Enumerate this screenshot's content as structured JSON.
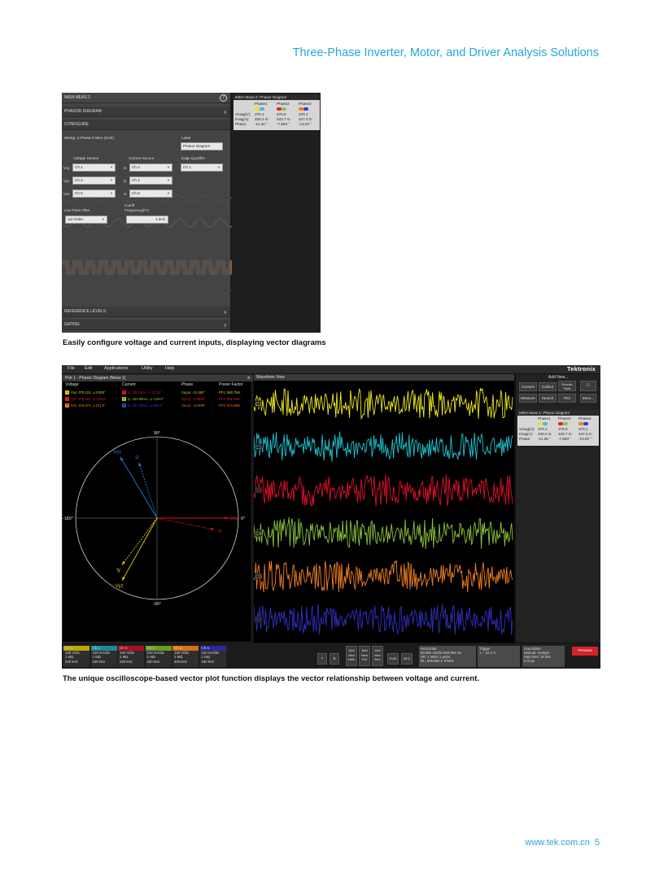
{
  "header": {
    "title": "Three-Phase Inverter, Motor, and Driver Analysis Solutions"
  },
  "figure1": {
    "caption": "Easily configure voltage and current inputs, displaying vector diagrams",
    "panel": {
      "title": "IMDA MEAS 2",
      "help": "?",
      "sections": [
        "PHASOR DIAGRAM",
        "CONFIGURE"
      ],
      "wiring": "Wiring: 3 Phase-3 Wire (3V3I)",
      "label_caption": "Label",
      "label_value": "Phasor Diagram",
      "voltage_source_label": "Voltage Source",
      "current_source_label": "Current Source",
      "edge_qualifier_label": "Edge Qualifier",
      "voltage_rows": [
        {
          "name": "Vxy",
          "value": "Ch 1"
        },
        {
          "name": "Vyz",
          "value": "Ch 3"
        },
        {
          "name": "Vzx",
          "value": "Ch 5"
        }
      ],
      "current_rows": [
        {
          "name": "Ix",
          "value": "Ch 2"
        },
        {
          "name": "Iy",
          "value": "Ch 4"
        },
        {
          "name": "Iz",
          "value": "Ch 6"
        }
      ],
      "edge_value": "Ch 1",
      "lpf_label": "Low Pass Filter",
      "lpf_value": "1st Order",
      "cutoff_label_1": "Cutoff",
      "cutoff_label_2": "Frequency(Fc)",
      "cutoff_value": "1 kHz",
      "bottom_sections": [
        "REFERENCE LEVELS",
        "GATING"
      ]
    },
    "meas": {
      "title": "IMDA Meas 2: Phasor Diagram",
      "phases": [
        "Phase1",
        "Phase2",
        "Phase3"
      ],
      "rows": [
        {
          "label": "Vmag(V):",
          "values": [
            "375.1",
            "376.5",
            "379.1"
          ]
        },
        {
          "label": "Imag(A):",
          "values": [
            "330.2 m",
            "343.7 m",
            "347.3 m"
          ]
        },
        {
          "label": "Phase:",
          "values": [
            "-11.26 °",
            "-7.563 °",
            "-13.00 °"
          ]
        }
      ]
    }
  },
  "figure2": {
    "caption": "The unique oscilloscope-based vector plot function displays the vector relationship between voltage and current.",
    "menu": [
      "File",
      "Edit",
      "Applications",
      "Utility",
      "Help"
    ],
    "brand": "Tektronix",
    "plot_title": "Plot 1 - Phasor Diagram (Meas 1)",
    "wave_title": "Waveform View",
    "columns": [
      "Voltage",
      "Current",
      "Phase",
      "Power Factor"
    ],
    "table": [
      {
        "v": "Vxy: 375.12V, ∠0.000°",
        "i": "Ix: 330.2mA, ∠-11.26°",
        "p": "Vxy,Ix: -11.260°",
        "pf": "PF1: 980.75m",
        "vc": "#e8d000",
        "ic": "#e0102a",
        "vn": "1",
        "in": "2"
      },
      {
        "v": "Vyz: 376.46V, ∠-119.2°",
        "i": "Iy: 343.68mA, ∠-126.8°",
        "p": "Vyz,Iy: -7.5630°",
        "pf": "PF2: 991.30m",
        "vc": "#e02030",
        "ic": "#9ccc2a",
        "vn": "3",
        "in": "4"
      },
      {
        "v": "Vzx: 375.07V, ∠121.0°",
        "i": "Iz: 347.30mA, ∠108.0°",
        "p": "Vzx,Iz: -12.998°",
        "pf": "PF3: 974.38m",
        "vc": "#f08020",
        "ic": "#3040c0",
        "vn": "5",
        "in": "6"
      }
    ],
    "angles": {
      "top": "90°",
      "bottom": "-90°",
      "left": "-180°",
      "right": "0°"
    },
    "vectors": [
      {
        "name": "Vxy",
        "angle": 0,
        "len": 0.88,
        "color": "#e0102a"
      },
      {
        "name": "Ix",
        "angle": -11.26,
        "len": 0.72,
        "color": "#e0102a"
      },
      {
        "name": "Vyz",
        "angle": -119.2,
        "len": 0.88,
        "color": "#e8d000"
      },
      {
        "name": "Iy",
        "angle": -126.8,
        "len": 0.72,
        "color": "#e8d000"
      },
      {
        "name": "Vzx",
        "angle": 121.0,
        "len": 0.88,
        "color": "#2d7fd0"
      },
      {
        "name": "Iz",
        "angle": 108.0,
        "len": 0.72,
        "color": "#2d7fd0"
      }
    ],
    "channels": [
      {
        "id": "C1",
        "color": "#f0ea1a"
      },
      {
        "id": "C2",
        "color": "#1fc3d0"
      },
      {
        "id": "C3",
        "color": "#e0102a"
      },
      {
        "id": "C4",
        "color": "#8cc43a"
      },
      {
        "id": "C5",
        "color": "#f08020"
      },
      {
        "id": "C6",
        "color": "#3030c0"
      }
    ],
    "add_new_label": "Add New...",
    "right_buttons": [
      "Cursors",
      "Callout",
      "Results Table",
      "Measure",
      "Search",
      "Plot",
      "More..."
    ],
    "right_meas": {
      "title": "IMDA Meas 1: Phasor Diagram",
      "phases": [
        "Phase1",
        "Phase2",
        "Phase3"
      ],
      "rows": [
        {
          "label": "Vmag(V):",
          "values": [
            "375.1",
            "376.5",
            "379.1"
          ]
        },
        {
          "label": "Imag(A):",
          "values": [
            "330.2 m",
            "343.7 m",
            "347.3 m"
          ]
        },
        {
          "label": "Phase:",
          "values": [
            "-11.26 °",
            "-7.563 °",
            "-13.00 °"
          ]
        }
      ]
    },
    "bottom_channels": [
      {
        "name": "Ch 1",
        "color": "#b8a800",
        "l1": "140 V/div",
        "l2": "1 MΩ",
        "l3": "200 kHz"
      },
      {
        "name": "Ch 2",
        "color": "#1a8a94",
        "l1": "210 mA/div",
        "l2": "1 MΩ",
        "l3": "200 kHz"
      },
      {
        "name": "Ch 3",
        "color": "#a81020",
        "l1": "140 V/div",
        "l2": "1 MΩ",
        "l3": "200 kHz"
      },
      {
        "name": "Ch 4",
        "color": "#6a9a28",
        "l1": "210 mA/div",
        "l2": "1 MΩ",
        "l3": "200 kHz"
      },
      {
        "name": "Ch 5",
        "color": "#d87018",
        "l1": "140 V/div",
        "l2": "1 MΩ",
        "l3": "200 kHz"
      },
      {
        "name": "Ch 6",
        "color": "#2a2aa0",
        "l1": "210 mA/div",
        "l2": "1 MΩ",
        "l3": "200 kHz"
      }
    ],
    "num_buttons": [
      "7",
      "8"
    ],
    "add_buttons": [
      "Add New Math",
      "Add New Ref",
      "Add New Bus"
    ],
    "extra_buttons": [
      "DVM",
      "AFG"
    ],
    "horizontal": {
      "title": "Horizontal",
      "l1": "50.984 ms/div   509.984 ms",
      "l2": "SR: 1 MS/s    1 μs/pt",
      "l3": "RL: 509.984 k   ▼50%"
    },
    "trigger": {
      "title": "Trigger",
      "l1": "1  ⟋  22.4 V"
    },
    "acquisition": {
      "title": "Acquisition",
      "l1": "Manual,     Analyze",
      "l2": "High Res: 16 bits",
      "l3": "0 Acqs"
    },
    "preview": "Preview"
  },
  "footer": {
    "url": "www.tek.com.cn",
    "page": "5"
  }
}
